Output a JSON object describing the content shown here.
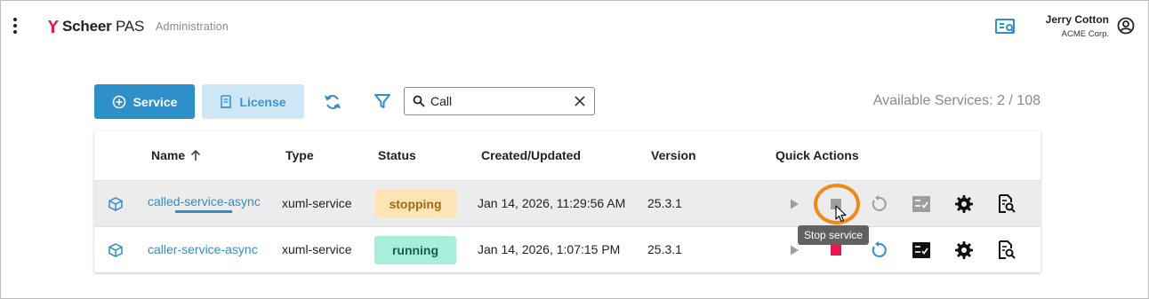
{
  "header": {
    "brand_bold": "Scheer",
    "brand_light": " PAS",
    "app_name": "Administration",
    "user_name": "Jerry Cotton",
    "user_org": "ACME Corp.",
    "icons": [
      "menu-kebab-icon",
      "scheer-logo",
      "services-list-icon",
      "account-circle-icon"
    ]
  },
  "toolbar": {
    "service_label": "Service",
    "license_label": "License",
    "search_value": "Call",
    "available_label": "Available Services: 2 / 108"
  },
  "table": {
    "columns": [
      "Name",
      "Type",
      "Status",
      "Created/Updated",
      "Version",
      "Quick Actions"
    ],
    "sort": {
      "column": "Name",
      "direction": "ascending"
    },
    "rows": [
      {
        "name": "called-service-async",
        "type": "xuml-service",
        "status": "stopping",
        "updated": "Jan 14, 2026, 11:29:56 AM",
        "version": "25.3.1"
      },
      {
        "name": "caller-service-async",
        "type": "xuml-service",
        "status": "running",
        "updated": "Jan 14, 2026, 1:07:15 PM",
        "version": "25.3.1"
      }
    ]
  },
  "tooltip": "Stop service",
  "colors": {
    "primary": "#2f8fc9",
    "license_bg": "#cfe7f5",
    "stopping_bg": "#fde3b5",
    "running_bg": "#a9eedb",
    "stop_red": "#e8194e",
    "highlight": "#ef8a16"
  }
}
